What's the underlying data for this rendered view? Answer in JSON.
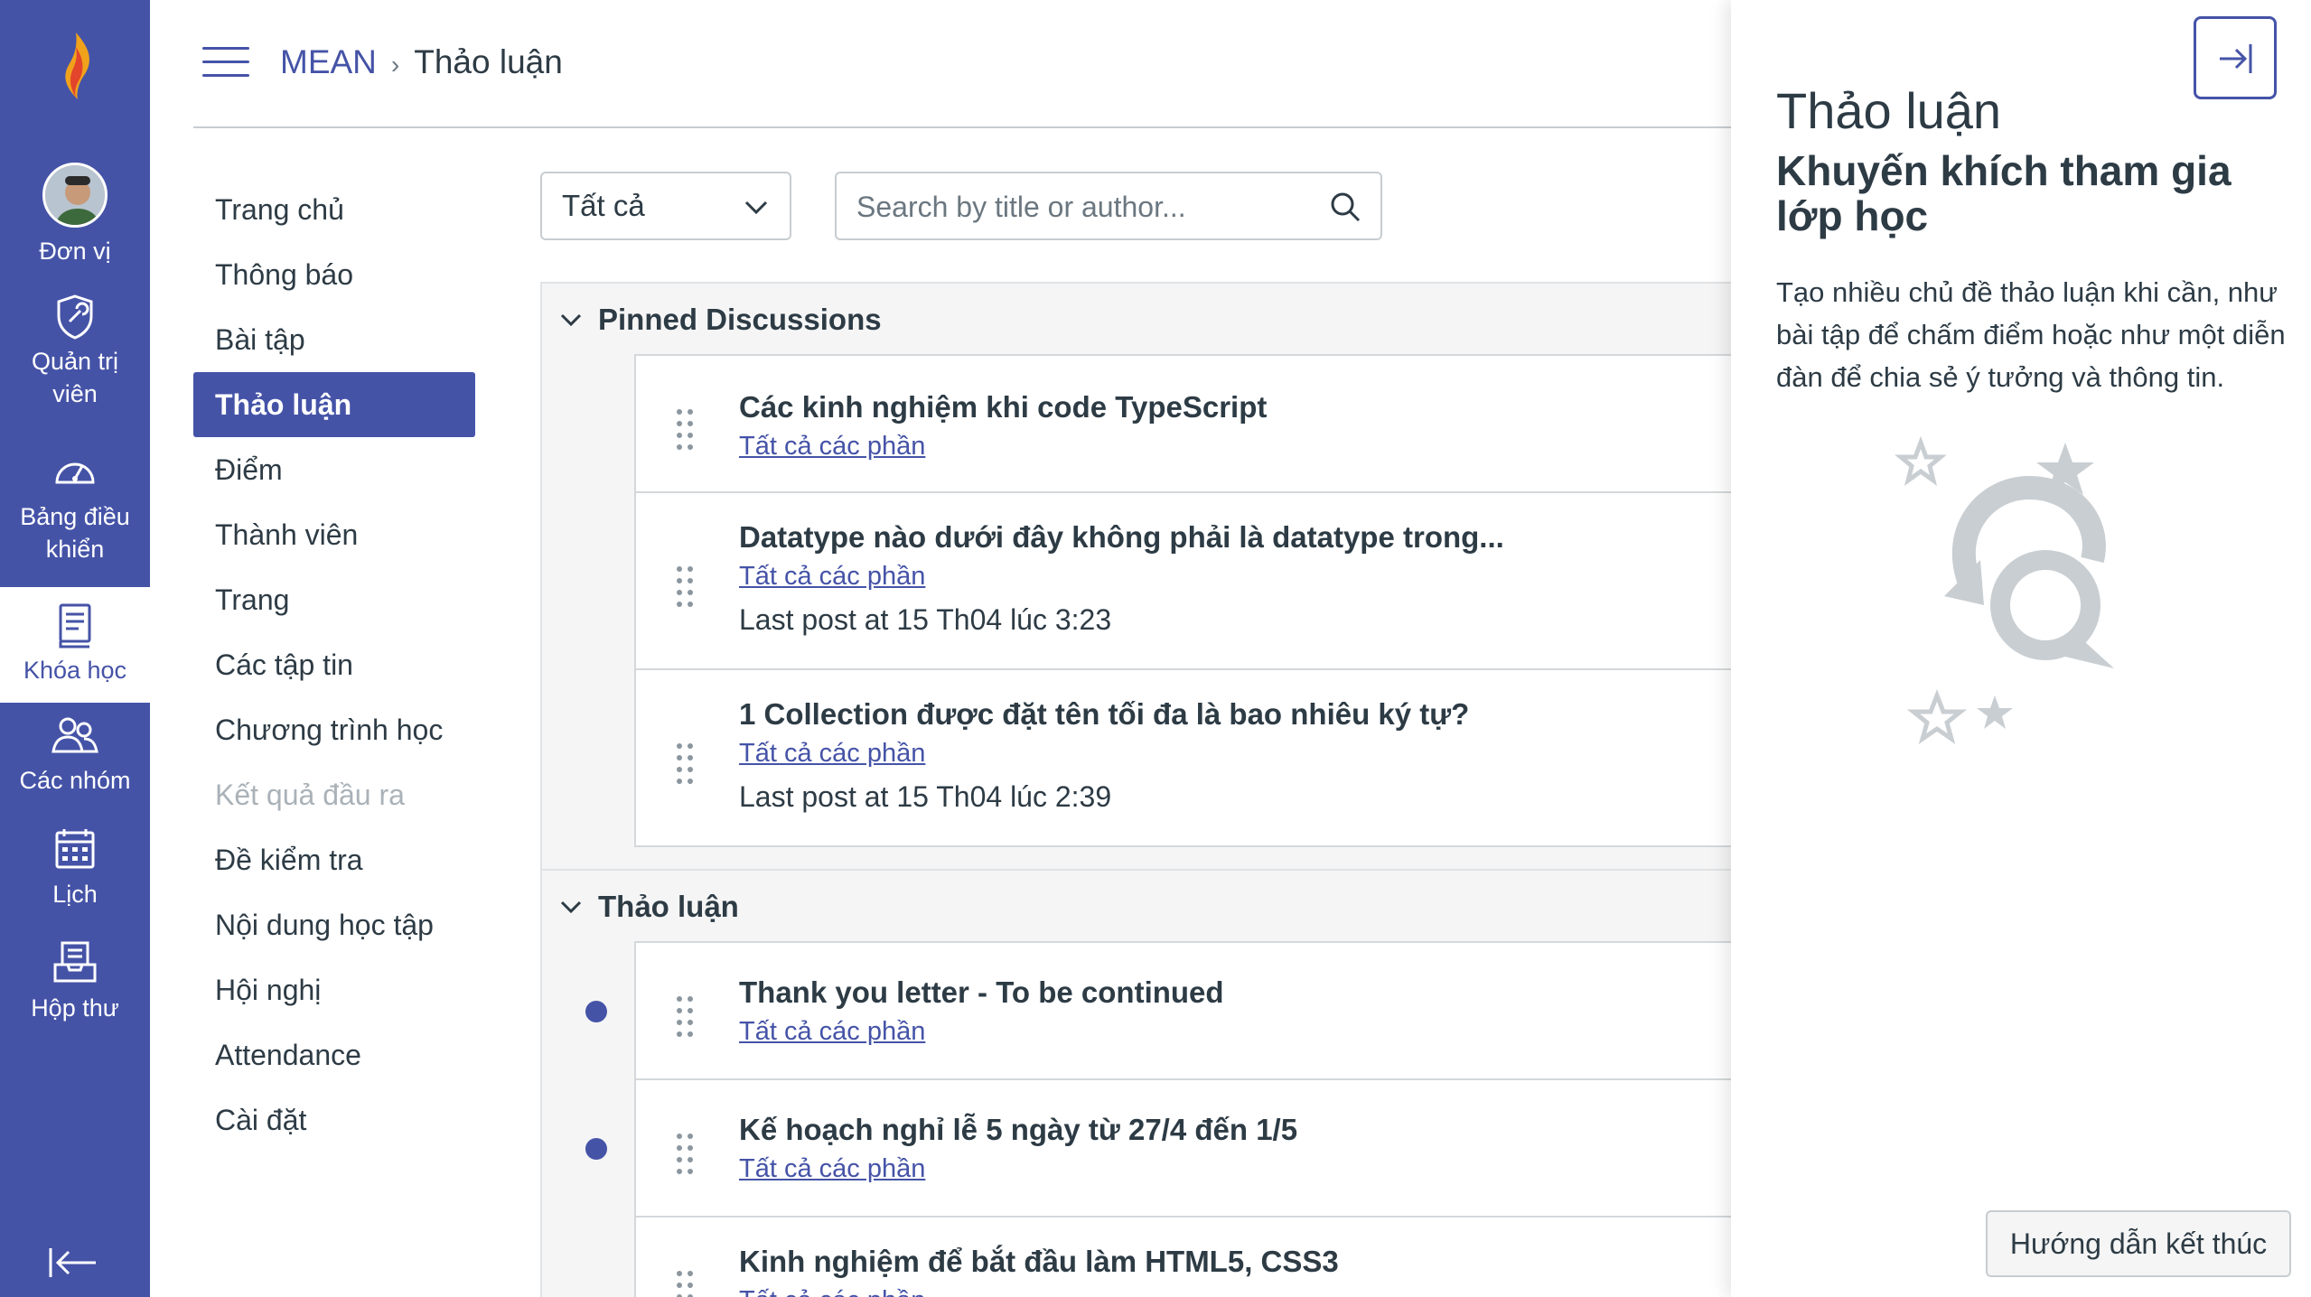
{
  "global_nav": {
    "items": [
      {
        "label": "Đơn vị",
        "icon": "avatar"
      },
      {
        "label": "Quản trị viên",
        "icon": "admin-shield-icon"
      },
      {
        "label": "Bảng điều khiển",
        "icon": "dashboard-icon"
      },
      {
        "label": "Khóa học",
        "icon": "courses-book-icon",
        "active": true
      },
      {
        "label": "Các nhóm",
        "icon": "groups-icon"
      },
      {
        "label": "Lịch",
        "icon": "calendar-icon"
      },
      {
        "label": "Hộp thư",
        "icon": "inbox-icon"
      }
    ]
  },
  "header": {
    "course": "MEAN",
    "current": "Thảo luận"
  },
  "course_nav": {
    "items": [
      {
        "label": "Trang chủ"
      },
      {
        "label": "Thông báo"
      },
      {
        "label": "Bài tập"
      },
      {
        "label": "Thảo luận",
        "active": true
      },
      {
        "label": "Điểm"
      },
      {
        "label": "Thành viên"
      },
      {
        "label": "Trang"
      },
      {
        "label": "Các tập tin"
      },
      {
        "label": "Chương trình học"
      },
      {
        "label": "Kết quả đầu ra",
        "disabled": true
      },
      {
        "label": "Đề kiểm tra"
      },
      {
        "label": "Nội dung học tập"
      },
      {
        "label": "Hội nghị"
      },
      {
        "label": "Attendance"
      },
      {
        "label": "Cài đặt"
      }
    ]
  },
  "filters": {
    "select_value": "Tất cả",
    "search_placeholder": "Search by title or author..."
  },
  "pinned": {
    "heading": "Pinned Discussions",
    "items": [
      {
        "title": "Các kinh nghiệm khi code TypeScript",
        "sections": "Tất cả các phần",
        "last_post": ""
      },
      {
        "title": "Datatype nào dưới đây không phải là datatype trong...",
        "sections": "Tất cả các phần",
        "last_post": "Last post at 15 Th04 lúc 3:23"
      },
      {
        "title": "1 Collection được đặt tên tối đa là bao nhiêu ký tự?",
        "sections": "Tất cả các phần",
        "last_post": "Last post at 15 Th04 lúc 2:39"
      }
    ]
  },
  "discussions": {
    "heading": "Thảo luận",
    "items": [
      {
        "title": "Thank you letter - To be continued",
        "sections": "Tất cả các phần",
        "unread": true
      },
      {
        "title": "Kế hoạch nghỉ lễ 5 ngày từ 27/4 đến 1/5",
        "sections": "Tất cả các phần",
        "unread": true
      },
      {
        "title": "Kinh nghiệm để bắt đầu làm HTML5, CSS3",
        "sections": "Tất cả các phần",
        "unread": false
      }
    ]
  },
  "tray": {
    "title": "Thảo luận",
    "subtitle": "Khuyến khích tham gia lớp học",
    "body": "Tạo nhiều chủ đề thảo luận khi cần, như bài tập để chấm điểm hoặc như một diễn đàn để chia sẻ ý tưởng và thông tin.",
    "finish_button": "Hướng dẫn kết thúc"
  },
  "colors": {
    "brand": "#4553a7",
    "text": "#2d3b45",
    "border": "#c7cdd1"
  }
}
